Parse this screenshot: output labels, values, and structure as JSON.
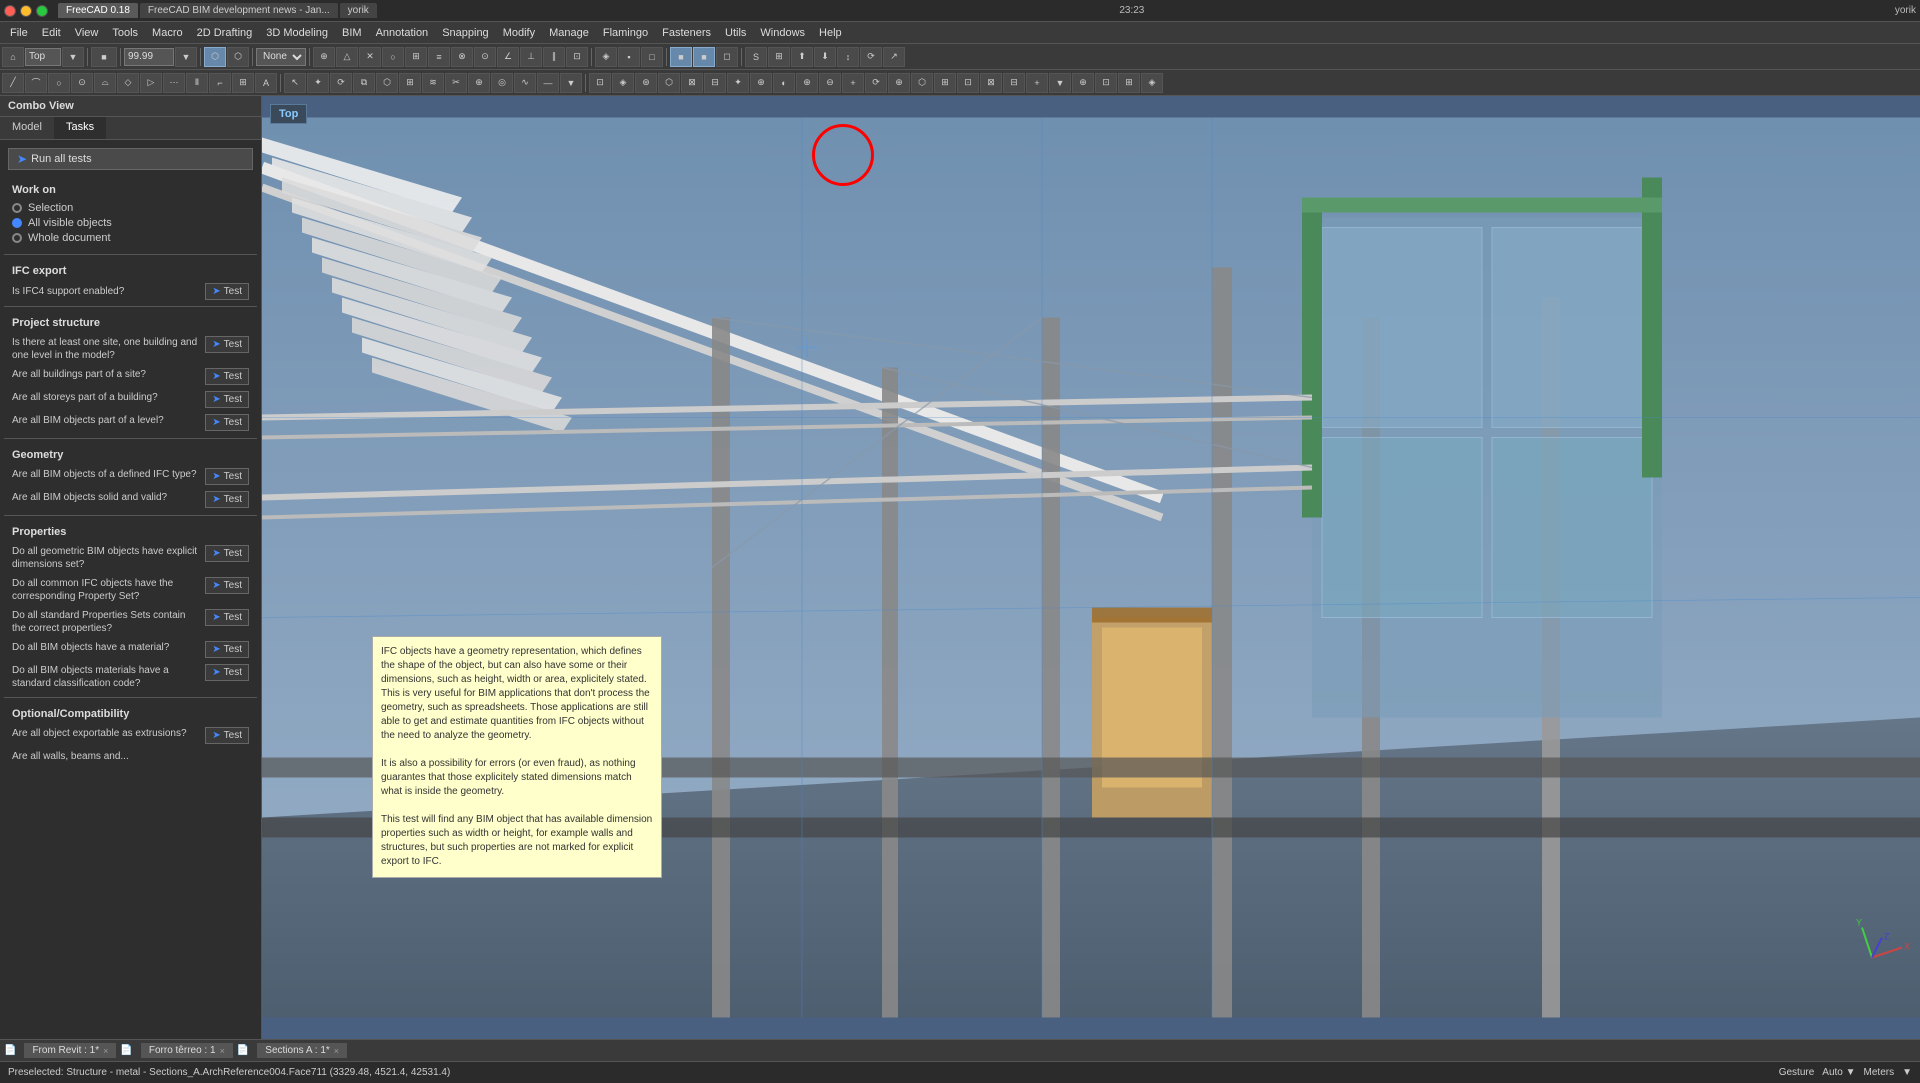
{
  "window": {
    "time": "23:23",
    "user": "yorik",
    "tabs": [
      {
        "label": "FreeCAD 0.18",
        "active": true
      },
      {
        "label": "FreeCAD BIM development news - Jan...",
        "active": false
      },
      {
        "label": "yorik",
        "active": false
      }
    ]
  },
  "menubar": {
    "items": [
      "File",
      "Edit",
      "View",
      "Tools",
      "Macro",
      "2D Drafting",
      "3D Modeling",
      "BIM",
      "Annotation",
      "Snapping",
      "Modify",
      "Manage",
      "Flamingo",
      "Fasteners",
      "Utils",
      "Windows",
      "Help"
    ]
  },
  "toolbar1": {
    "view_label": "Top",
    "zoom_value": "99.99",
    "snap_label": "None"
  },
  "left_panel": {
    "combo_view_label": "Combo View",
    "tabs": [
      {
        "label": "Model",
        "active": false
      },
      {
        "label": "Tasks",
        "active": true
      }
    ],
    "run_all_btn": "Run all tests",
    "work_on_label": "Work on",
    "radio_options": [
      {
        "label": "Selection",
        "selected": false
      },
      {
        "label": "All visible objects",
        "selected": true
      },
      {
        "label": "Whole document",
        "selected": false
      }
    ],
    "ifc_export_label": "IFC export",
    "ifc_test_label": "Is IFC4 support enabled?",
    "ifc_test_btn": "Test",
    "project_structure_label": "Project structure",
    "project_checks": [
      {
        "label": "Is there at least one site, one building and one level in the model?",
        "btn": "Test"
      },
      {
        "label": "Are all buildings part of a site?",
        "btn": "Test"
      },
      {
        "label": "Are all storeys part of a building?",
        "btn": "Test"
      },
      {
        "label": "Are all BIM objects part of a level?",
        "btn": "Test"
      }
    ],
    "geometry_label": "Geometry",
    "geometry_checks": [
      {
        "label": "Are all BIM objects of a defined IFC type?",
        "btn": "Test"
      },
      {
        "label": "Are all BIM objects solid and valid?",
        "btn": "Test"
      }
    ],
    "properties_label": "Properties",
    "properties_checks": [
      {
        "label": "Do all geometric BIM objects have explicit dimensions set?",
        "btn": "Test"
      },
      {
        "label": "Do all common IFC objects have the corresponding Property Set?",
        "btn": "Test"
      },
      {
        "label": "Do all standard Properties Sets contain the correct properties?",
        "btn": "Test"
      },
      {
        "label": "Do all BIM objects have a material?",
        "btn": "Test"
      },
      {
        "label": "Do all BIM objects materials have a standard classification code?",
        "btn": "Test"
      }
    ],
    "optional_label": "Optional/Compatibility",
    "optional_checks": [
      {
        "label": "Are all object exportable as extrusions?",
        "btn": "Test"
      },
      {
        "label": "Are all walls, beams and...",
        "btn": ""
      }
    ]
  },
  "tooltip": {
    "text": "IFC objects have a geometry representation, which defines the shape of the object, but can also have some or their dimensions, such as height, width or area, explicitely stated. This is very useful for BIM applications that don't process the geometry, such as spreadsheets. Those applications are still able to get and estimate quantities from IFC objects without the need to analyze the geometry.\n\nIt is also a possibility for errors (or even fraud), as nothing guarantes that those explicitely stated dimensions match what is inside the geometry.\n\nThis test will find any BIM object that has available dimension properties such as width or height, for example walls and structures, but such properties are not marked for explicit export to IFC."
  },
  "bottom_tabs": [
    {
      "label": "From Revit : 1*",
      "icon": "📄"
    },
    {
      "label": "Forro têrreo : 1",
      "icon": "📄"
    },
    {
      "label": "Sections A : 1*",
      "icon": "📄"
    }
  ],
  "status_bar": {
    "text": "Preselected: Structure - metal - Sections_A.ArchReference004.Face711 (3329.48, 4521.4, 42531.4)",
    "gesture": "Gesture",
    "auto": "Auto ▼",
    "meters": "Meters",
    "zoom": "▼"
  },
  "view_cube": "Top",
  "colors": {
    "accent_blue": "#4488ff",
    "panel_bg": "#2e2e2e",
    "viewport_bg": "#4a6080",
    "red_circle": "#ff0000"
  }
}
